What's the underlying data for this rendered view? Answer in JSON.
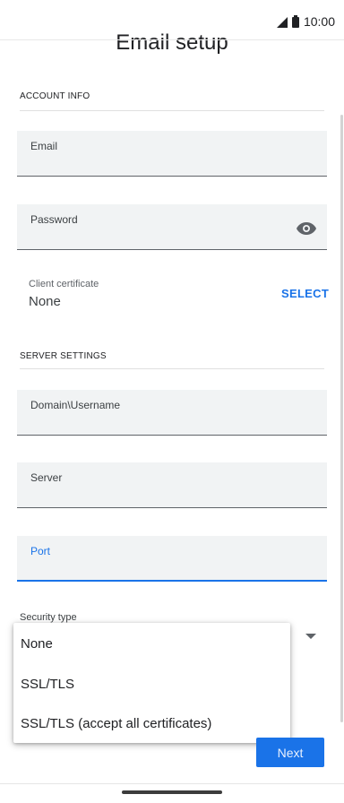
{
  "status_bar": {
    "time": "10:00"
  },
  "page": {
    "title": "Email setup"
  },
  "account_info": {
    "section_label": "ACCOUNT INFO",
    "email_label": "Email",
    "password_label": "Password",
    "client_certificate_label": "Client certificate",
    "client_certificate_value": "None",
    "select_label": "SELECT"
  },
  "server_settings": {
    "section_label": "SERVER SETTINGS",
    "domain_username_label": "Domain\\Username",
    "server_label": "Server",
    "port_label": "Port",
    "security_type_label": "Security type"
  },
  "security_menu": {
    "options": [
      "None",
      "SSL/TLS",
      "SSL/TLS (accept all certificates)"
    ]
  },
  "actions": {
    "next_label": "Next"
  },
  "colors": {
    "accent": "#1a73e8",
    "field_bg": "#f1f3f4"
  }
}
